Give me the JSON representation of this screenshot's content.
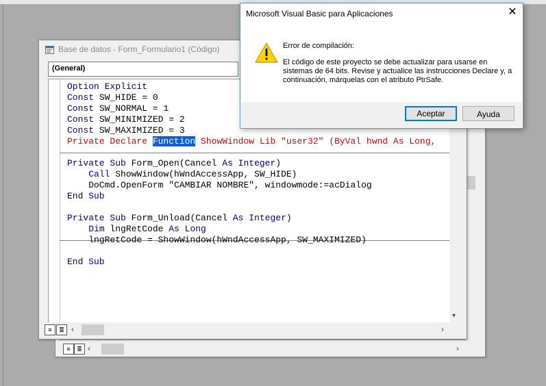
{
  "code_window": {
    "title": "Base de datos - Form_Formulario1 (Código)",
    "object_combo": "(General)",
    "icon": "form-code-icon"
  },
  "code": {
    "lines": [
      "Option Explicit",
      "Const SW_HIDE = 0",
      "Const SW_NORMAL = 1",
      "Const SW_MINIMIZED = 2",
      "Const SW_MAXIMIZED = 3",
      "Private Declare Function ShowWindow Lib \"user32\" (ByVal hwnd As Long,",
      "",
      "Private Sub Form_Open(Cancel As Integer)",
      "    Call ShowWindow(hWndAccessApp, SW_HIDE)",
      "    DoCmd.OpenForm \"CAMBIAR NOMBRE\", windowmode:=acDialog",
      "End Sub",
      "",
      "Private Sub Form_Unload(Cancel As Integer)",
      "    Dim lngRetCode As Long",
      "    lngRetCode = ShowWindow(hWndAccessApp, SW_MAXIMIZED)",
      "",
      "End Sub"
    ],
    "declare_prefix": "Private Declare ",
    "declare_selected": "Function",
    "declare_suffix": " ShowWindow Lib \"user32\" (ByVal hwnd As Long,"
  },
  "dialog": {
    "title": "Microsoft Visual Basic para Aplicaciones",
    "heading": "Error de compilación:",
    "message": "El código de este proyecto se debe actualizar para usarse en sistemas de 64 bits. Revise y actualice las instrucciones Declare y, a continuación, márquelas con el atributo PtrSafe.",
    "accept_label": "Aceptar",
    "help_label": "Ayuda",
    "close_label": "✕",
    "icon": "warning-icon"
  },
  "colors": {
    "keyword": "#00008b",
    "error_line": "#e00000",
    "selection": "#0a5fd1",
    "primary_button_border": "#0078d7"
  }
}
